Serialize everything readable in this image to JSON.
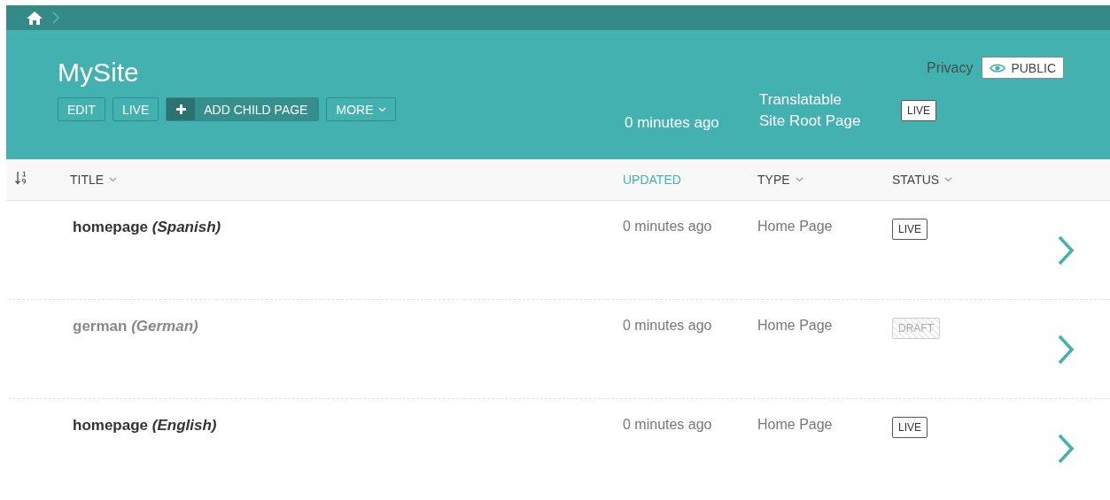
{
  "header": {
    "title": "MySite",
    "actions": [
      {
        "label": "EDIT",
        "kind": "plain"
      },
      {
        "label": "LIVE",
        "kind": "plain"
      },
      {
        "label": "ADD CHILD PAGE",
        "kind": "add"
      },
      {
        "label": "MORE",
        "kind": "dropdown"
      }
    ],
    "updated": "0 minutes ago",
    "type": "Translatable Site Root Page",
    "status": {
      "label": "LIVE",
      "kind": "live"
    },
    "privacy_label": "Privacy",
    "privacy_button": "PUBLIC"
  },
  "table": {
    "columns": [
      {
        "label": "TITLE",
        "selected": false
      },
      {
        "label": "UPDATED",
        "selected": true
      },
      {
        "label": "TYPE",
        "selected": false
      },
      {
        "label": "STATUS",
        "selected": false
      }
    ],
    "rows": [
      {
        "title": "homepage *(Spanish)*",
        "updated": "0 minutes ago",
        "type": "Home Page",
        "status": {
          "label": "LIVE",
          "kind": "live"
        }
      },
      {
        "title": "german *(German)*",
        "updated": "0 minutes ago",
        "type": "Home Page",
        "status": {
          "label": "DRAFT",
          "kind": "draft"
        }
      },
      {
        "title": "homepage *(English)*",
        "updated": "0 minutes ago",
        "type": "Home Page",
        "status": {
          "label": "LIVE",
          "kind": "live"
        }
      }
    ]
  }
}
